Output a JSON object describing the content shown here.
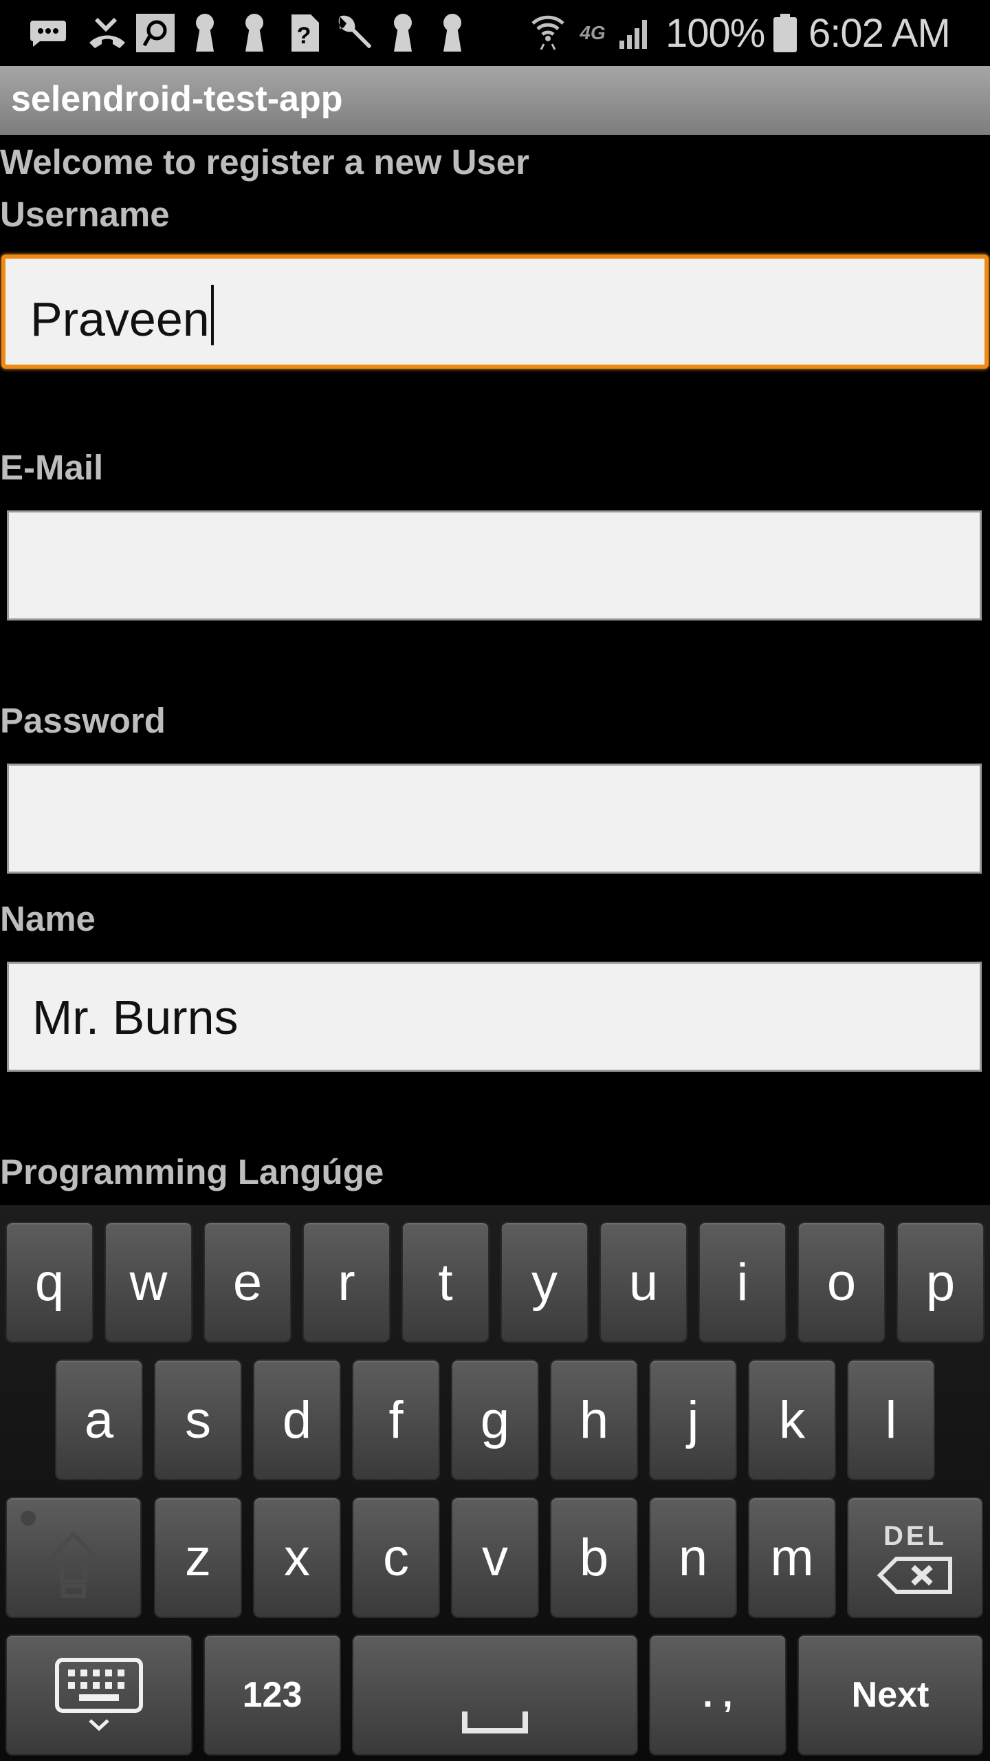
{
  "status_bar": {
    "left_icons": [
      "message-icon",
      "missed-call-icon",
      "p-app-icon",
      "keyhole-icon",
      "keyhole-icon",
      "help-icon",
      "wrench-icon",
      "keyhole-icon",
      "keyhole-icon"
    ],
    "right_icons": [
      "wifi-icon",
      "4g-lte-icon",
      "signal-icon"
    ],
    "network": "4G",
    "battery": "100%",
    "time": "6:02 AM"
  },
  "app": {
    "title": "selendroid-test-app"
  },
  "form": {
    "welcome": "Welcome to register a new User",
    "username_label": "Username",
    "username_value": "Praveen",
    "email_label": "E-Mail",
    "email_value": "",
    "password_label": "Password",
    "password_value": "",
    "name_label": "Name",
    "name_value": "Mr. Burns",
    "language_label": "Programming Langúge"
  },
  "keyboard": {
    "row1": [
      "q",
      "w",
      "e",
      "r",
      "t",
      "y",
      "u",
      "i",
      "o",
      "p"
    ],
    "row2": [
      "a",
      "s",
      "d",
      "f",
      "g",
      "h",
      "j",
      "k",
      "l"
    ],
    "row3": [
      "z",
      "x",
      "c",
      "v",
      "b",
      "n",
      "m"
    ],
    "del_label": "DEL",
    "numbers_label": "123",
    "punct_label": ". ,",
    "next_label": "Next"
  },
  "colors": {
    "focus_border": "#f08a14",
    "field_bg": "#f1f1f1",
    "label_text": "#bdbdbd"
  }
}
